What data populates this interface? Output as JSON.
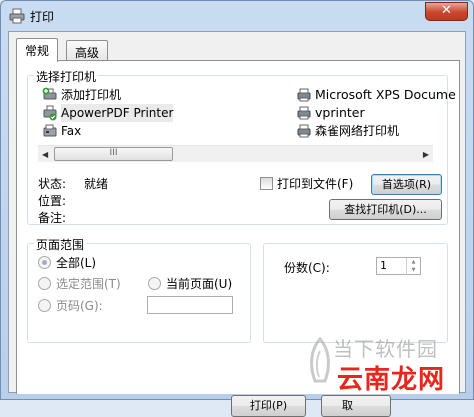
{
  "window": {
    "title": "打印",
    "close_glyph": "✕",
    "icon": "printer-icon"
  },
  "tabs": [
    {
      "label": "常规",
      "active": true
    },
    {
      "label": "高级",
      "active": false
    }
  ],
  "select_printer": {
    "legend": "选择打印机",
    "printers": [
      {
        "name": "添加打印机",
        "icon": "add-printer-icon"
      },
      {
        "name": "ApowerPDF Printer",
        "icon": "default-printer-icon",
        "selected": true
      },
      {
        "name": "Fax",
        "icon": "fax-icon"
      },
      {
        "name": "Microsoft XPS Docume",
        "icon": "printer-icon"
      },
      {
        "name": "vprinter",
        "icon": "printer-icon"
      },
      {
        "name": "森雀网络打印机",
        "icon": "printer-icon"
      }
    ],
    "scroll_thumb_grip": "III",
    "scroll_left": "◀",
    "scroll_right": "▶"
  },
  "status": {
    "status_label": "状态:",
    "status_value": "就绪",
    "location_label": "位置:",
    "comment_label": "备注:",
    "print_to_file_label": "打印到文件(F)",
    "print_to_file_checked": false,
    "preferences_button": "首选项(R)",
    "find_printer_button": "查找打印机(D)..."
  },
  "page_range": {
    "legend": "页面范围",
    "all_label": "全部(L)",
    "selection_label": "选定范围(T)",
    "current_page_label": "当前页面(U)",
    "pages_label": "页码(G):",
    "pages_value": "",
    "selected": "all"
  },
  "copies": {
    "label": "份数(C):",
    "value": "1",
    "up": "▲",
    "down": "▼"
  },
  "footer": {
    "print_button": "打印(P)",
    "cancel_button": "取"
  },
  "watermark": {
    "top_text": "当下软件园",
    "bottom_text": "云南龙网"
  },
  "colors": {
    "title_bar": "#c9dcf1",
    "close_button": "#c9462c",
    "default_button_border": "#3c7fb1",
    "watermark_red": "#e8261e"
  }
}
